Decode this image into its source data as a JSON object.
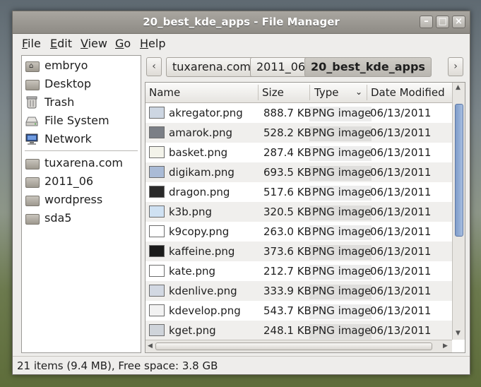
{
  "window": {
    "title": "20_best_kde_apps - File Manager",
    "buttons": {
      "minimize": "–",
      "maximize": "□",
      "close": "×"
    }
  },
  "menubar": {
    "items": [
      {
        "label": "File",
        "mnemonic": "F",
        "rest": "ile"
      },
      {
        "label": "Edit",
        "mnemonic": "E",
        "rest": "dit"
      },
      {
        "label": "View",
        "mnemonic": "V",
        "rest": "iew"
      },
      {
        "label": "Go",
        "mnemonic": "G",
        "rest": "o"
      },
      {
        "label": "Help",
        "mnemonic": "H",
        "rest": "elp"
      }
    ]
  },
  "sidebar": {
    "places": [
      {
        "label": "embryo",
        "icon": "home-folder-icon"
      },
      {
        "label": "Desktop",
        "icon": "desktop-folder-icon"
      },
      {
        "label": "Trash",
        "icon": "trash-icon"
      },
      {
        "label": "File System",
        "icon": "drive-icon"
      },
      {
        "label": "Network",
        "icon": "network-icon"
      }
    ],
    "bookmarks": [
      {
        "label": "tuxarena.com",
        "icon": "folder-icon"
      },
      {
        "label": "2011_06",
        "icon": "folder-icon"
      },
      {
        "label": "wordpress",
        "icon": "folder-icon"
      },
      {
        "label": "sda5",
        "icon": "folder-icon"
      }
    ]
  },
  "pathbar": {
    "back": "‹",
    "forward": "›",
    "crumbs": [
      "tuxarena.com",
      "2011_06",
      "20_best_kde_apps"
    ]
  },
  "filelist": {
    "columns": {
      "name": "Name",
      "size": "Size",
      "type": "Type",
      "date": "Date Modified"
    },
    "rows": [
      {
        "name": "akregator.png",
        "size": "888.7 KB",
        "type": "PNG image",
        "date": "06/13/2011"
      },
      {
        "name": "amarok.png",
        "size": "528.2 KB",
        "type": "PNG image",
        "date": "06/13/2011"
      },
      {
        "name": "basket.png",
        "size": "287.4 KB",
        "type": "PNG image",
        "date": "06/13/2011"
      },
      {
        "name": "digikam.png",
        "size": "693.5 KB",
        "type": "PNG image",
        "date": "06/13/2011"
      },
      {
        "name": "dragon.png",
        "size": "517.6 KB",
        "type": "PNG image",
        "date": "06/13/2011"
      },
      {
        "name": "k3b.png",
        "size": "320.5 KB",
        "type": "PNG image",
        "date": "06/13/2011"
      },
      {
        "name": "k9copy.png",
        "size": "263.0 KB",
        "type": "PNG image",
        "date": "06/13/2011"
      },
      {
        "name": "kaffeine.png",
        "size": "373.6 KB",
        "type": "PNG image",
        "date": "06/13/2011"
      },
      {
        "name": "kate.png",
        "size": "212.7 KB",
        "type": "PNG image",
        "date": "06/13/2011"
      },
      {
        "name": "kdenlive.png",
        "size": "333.9 KB",
        "type": "PNG image",
        "date": "06/13/2011"
      },
      {
        "name": "kdevelop.png",
        "size": "543.7 KB",
        "type": "PNG image",
        "date": "06/13/2011"
      },
      {
        "name": "kget.png",
        "size": "248.1 KB",
        "type": "PNG image",
        "date": "06/13/2011"
      }
    ]
  },
  "statusbar": {
    "text": "21 items (9.4 MB), Free space: 3.8 GB"
  }
}
